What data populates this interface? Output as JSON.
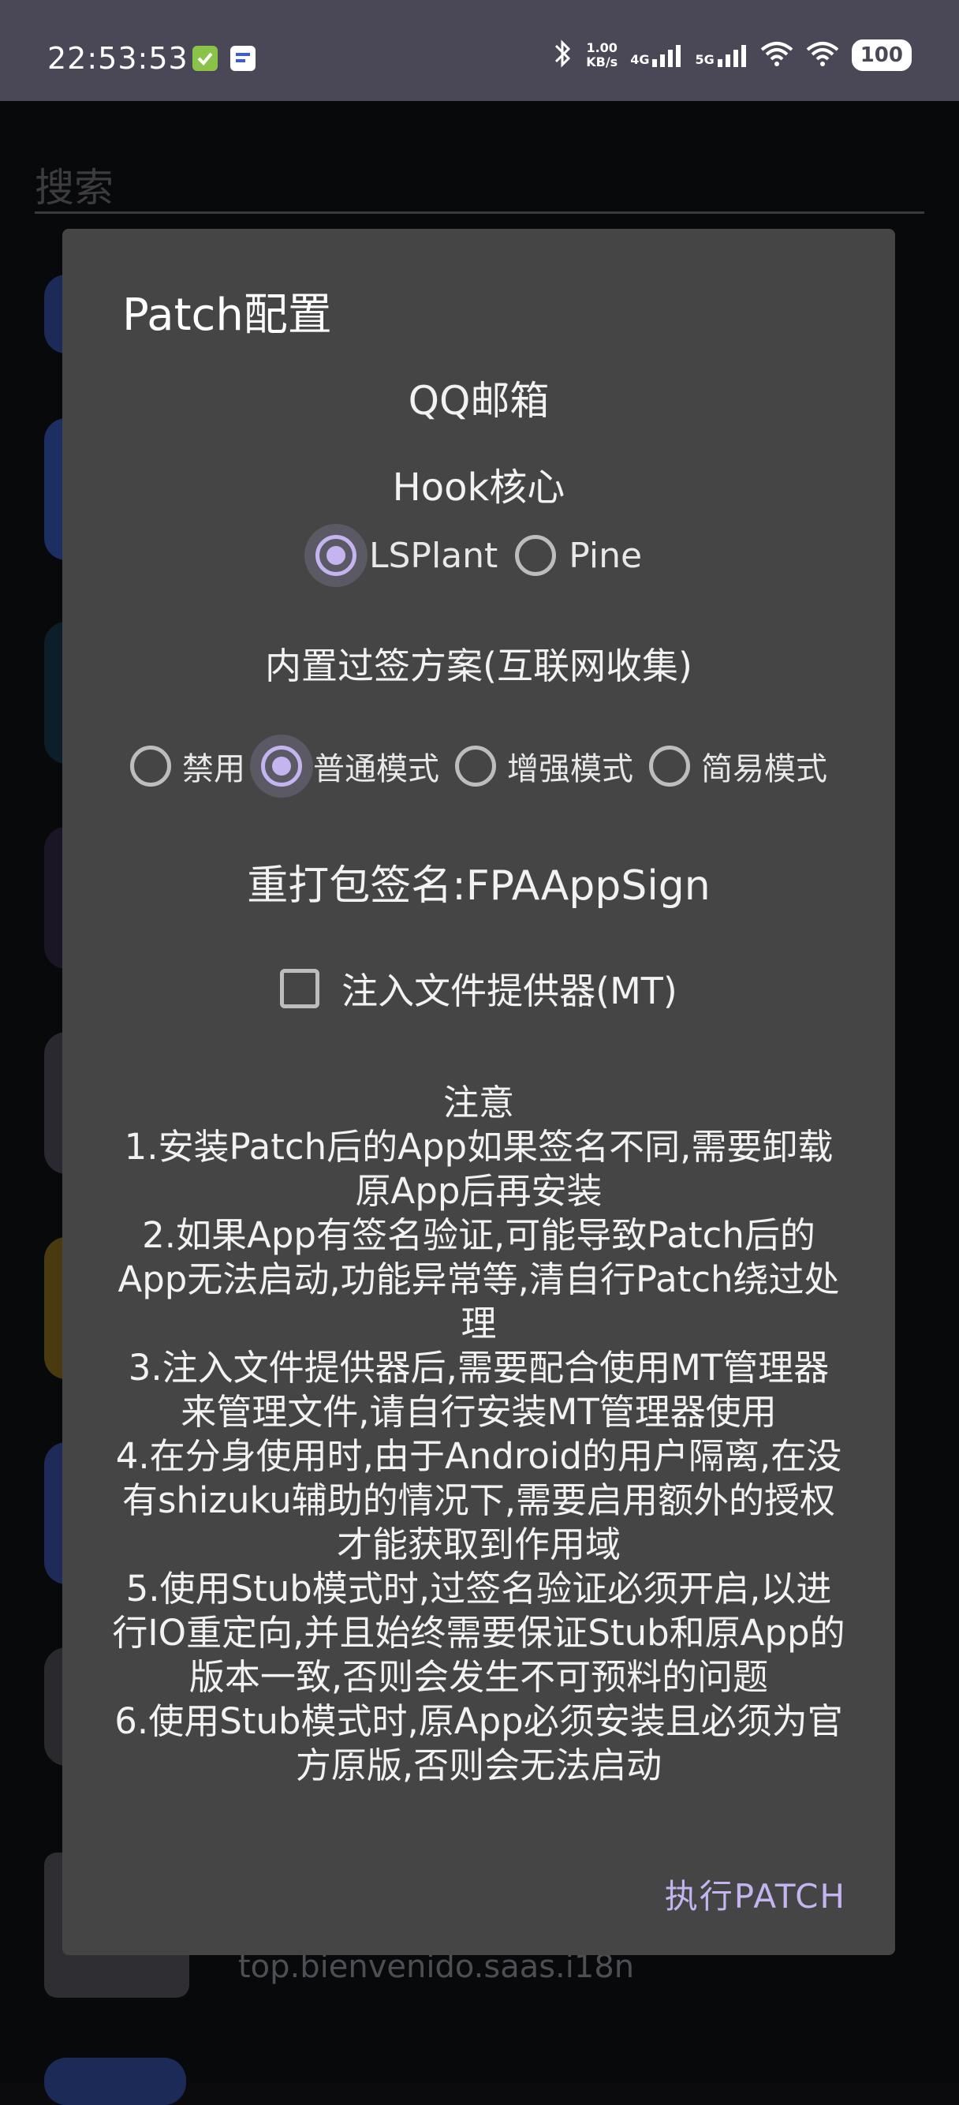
{
  "status_bar": {
    "time": "22:53:53",
    "net_speed": "1.00",
    "net_speed_unit": "KB/s",
    "net_4g": "4G",
    "net_5g": "5G",
    "battery": "100"
  },
  "background": {
    "search_placeholder": "搜索",
    "partial_package": "top.bienvenido.saas.i18n"
  },
  "dialog": {
    "title": "Patch配置",
    "app_name": "QQ邮箱",
    "hook_label": "Hook核心",
    "hook_options": [
      {
        "label": "LSPlant",
        "checked": true
      },
      {
        "label": "Pine",
        "checked": false
      }
    ],
    "sig_label": "内置过签方案(互联网收集)",
    "sig_options": [
      {
        "label": "禁用",
        "checked": false
      },
      {
        "label": "普通模式",
        "checked": true
      },
      {
        "label": "增强模式",
        "checked": false
      },
      {
        "label": "简易模式",
        "checked": false
      }
    ],
    "resign": "重打包签名:FPAAppSign",
    "inject_checkbox": "注入文件提供器(MT)",
    "notes": [
      "注意",
      "1.安装Patch后的App如果签名不同,需要卸载",
      "原App后再安装",
      "2.如果App有签名验证,可能导致Patch后的",
      "App无法启动,功能异常等,清自行Patch绕过处",
      "理",
      "3.注入文件提供器后,需要配合使用MT管理器",
      "来管理文件,请自行安装MT管理器使用",
      "4.在分身使用时,由于Android的用户隔离,在没",
      "有shizuku辅助的情况下,需要启用额外的授权",
      "才能获取到作用域",
      "5.使用Stub模式时,过签名验证必须开启,以进",
      "行IO重定向,并且始终需要保证Stub和原App的",
      "版本一致,否则会发生不可预料的问题",
      "6.使用Stub模式时,原App必须安装且必须为官",
      "方原版,否则会无法启动"
    ],
    "action": "执行PATCH"
  },
  "colors": {
    "accent": "#c4b5f0",
    "dialog_bg": "#454545",
    "status_bar_bg": "#4a4756"
  }
}
